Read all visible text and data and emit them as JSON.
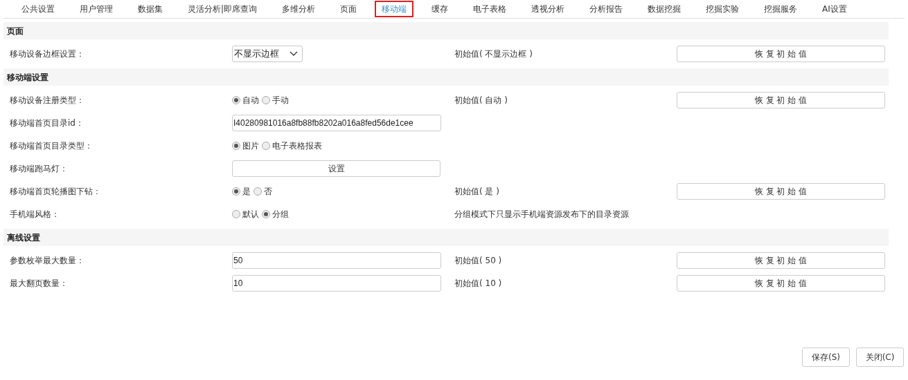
{
  "tabs": [
    {
      "label": "公共设置",
      "selected": false
    },
    {
      "label": "用户管理",
      "selected": false
    },
    {
      "label": "数据集",
      "selected": false
    },
    {
      "label": "灵活分析|即席查询",
      "selected": false
    },
    {
      "label": "多维分析",
      "selected": false
    },
    {
      "label": "页面",
      "selected": false
    },
    {
      "label": "移动端",
      "selected": true
    },
    {
      "label": "缓存",
      "selected": false
    },
    {
      "label": "电子表格",
      "selected": false
    },
    {
      "label": "透视分析",
      "selected": false
    },
    {
      "label": "分析报告",
      "selected": false
    },
    {
      "label": "数据挖掘",
      "selected": false
    },
    {
      "label": "挖掘实验",
      "selected": false
    },
    {
      "label": "挖掘服务",
      "selected": false
    },
    {
      "label": "AI设置",
      "selected": false
    }
  ],
  "sections": [
    {
      "title": "页面",
      "rows": [
        {
          "kind": "select",
          "label": "移动设备边框设置：",
          "value": "不显示边框",
          "initial": "初始值( 不显示边框 )",
          "reset": "恢 复 初 始 值"
        }
      ]
    },
    {
      "title": "移动端设置",
      "rows": [
        {
          "kind": "radio",
          "label": "移动设备注册类型：",
          "options": [
            {
              "label": "自动",
              "selected": true
            },
            {
              "label": "手动",
              "selected": false
            }
          ],
          "initial": "初始值( 自动 )",
          "reset": "恢 复 初 始 值"
        },
        {
          "kind": "input",
          "label": "移动端首页目录id：",
          "value": "I40280981016a8fb88fb8202a016a8fed56de1cee"
        },
        {
          "kind": "radio",
          "label": "移动端首页目录类型：",
          "options": [
            {
              "label": "图片",
              "selected": true
            },
            {
              "label": "电子表格报表",
              "selected": false
            }
          ]
        },
        {
          "kind": "button",
          "label": "移动端跑马灯：",
          "value": "设置"
        },
        {
          "kind": "radio",
          "label": "移动端首页轮播图下钻：",
          "options": [
            {
              "label": "是",
              "selected": true
            },
            {
              "label": "否",
              "selected": false
            }
          ],
          "initial": "初始值( 是 )",
          "reset": "恢 复 初 始 值"
        },
        {
          "kind": "radio",
          "label": "手机端风格：",
          "options": [
            {
              "label": "默认",
              "selected": false
            },
            {
              "label": "分组",
              "selected": true
            }
          ],
          "note": "分组模式下只显示手机端资源发布下的目录资源"
        }
      ]
    },
    {
      "title": "离线设置",
      "rows": [
        {
          "kind": "input",
          "label": "参数枚举最大数量：",
          "value": "50",
          "initial": "初始值( 50 )",
          "reset": "恢 复 初 始 值"
        },
        {
          "kind": "input",
          "label": "最大翻页数量：",
          "value": "10",
          "initial": "初始值( 10 )",
          "reset": "恢 复 初 始 值"
        }
      ]
    }
  ],
  "footer_buttons": [
    "保存(S)",
    "关闭(C)"
  ]
}
